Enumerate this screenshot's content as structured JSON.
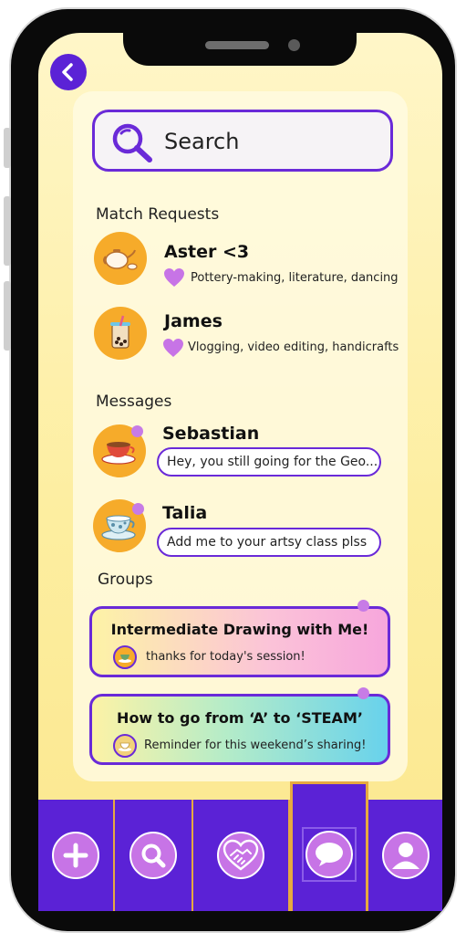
{
  "search": {
    "label": "Search"
  },
  "match_requests": {
    "heading": "Match Requests",
    "items": [
      {
        "name": "Aster <3",
        "interests": "Pottery-making, literature, dancing",
        "avatar_icon": "teapot-icon"
      },
      {
        "name": "James",
        "interests": "Vlogging, video editing, handicrafts",
        "avatar_icon": "bubble-tea-icon"
      }
    ]
  },
  "messages": {
    "heading": "Messages",
    "items": [
      {
        "name": "Sebastian",
        "preview": "Hey, you still going for the Geo...",
        "avatar_icon": "tea-cup-icon",
        "unread": true
      },
      {
        "name": "Talia",
        "preview": "Add me to your artsy class plss",
        "avatar_icon": "floral-tea-cup-icon",
        "unread": true
      }
    ]
  },
  "groups": {
    "heading": "Groups",
    "items": [
      {
        "title": "Intermediate Drawing with Me!",
        "preview": "thanks for today's session!",
        "unread": true
      },
      {
        "title": "How to go from ‘A’ to ‘STEAM’",
        "preview": "Reminder for this weekend’s sharing!",
        "unread": true
      }
    ]
  },
  "nav": {
    "tabs": [
      {
        "icon": "plus-icon",
        "active": false
      },
      {
        "icon": "search-icon",
        "active": false
      },
      {
        "icon": "handshake-heart-icon",
        "active": false
      },
      {
        "icon": "chat-bubble-icon",
        "active": true
      },
      {
        "icon": "profile-icon",
        "active": false
      }
    ]
  },
  "colors": {
    "accent_purple": "#5b22d6",
    "border_gold": "#e7a940",
    "heart_pink": "#c774e6",
    "avatar_orange": "#f6ab2a"
  }
}
